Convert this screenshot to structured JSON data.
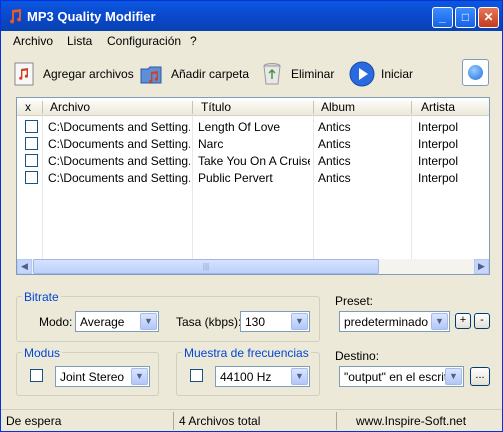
{
  "window": {
    "title": "MP3 Quality Modifier"
  },
  "menu": {
    "items": [
      "Archivo",
      "Lista",
      "Configuración",
      "?"
    ]
  },
  "toolbar": {
    "add_files": "Agregar archivos",
    "add_folder": "Añadir carpeta",
    "remove": "Eliminar",
    "start": "Iniciar"
  },
  "list": {
    "headers": [
      "x",
      "Archivo",
      "Título",
      "Album",
      "Artista"
    ],
    "rows": [
      {
        "file": "C:\\Documents and Setting...",
        "title": "Length Of Love",
        "album": "Antics",
        "artist": "Interpol"
      },
      {
        "file": "C:\\Documents and Setting...",
        "title": "Narc",
        "album": "Antics",
        "artist": "Interpol"
      },
      {
        "file": "C:\\Documents and Setting...",
        "title": "Take You On A Cruise",
        "album": "Antics",
        "artist": "Interpol"
      },
      {
        "file": "C:\\Documents and Setting...",
        "title": "Public Pervert",
        "album": "Antics",
        "artist": "Interpol"
      }
    ]
  },
  "bitrate": {
    "group_label": "Bitrate",
    "mode_label": "Modo:",
    "mode_value": "Average",
    "rate_label": "Tasa (kbps):",
    "rate_value": "130"
  },
  "preset": {
    "label": "Preset:",
    "value": "predeterminado",
    "add": "+",
    "remove": "-"
  },
  "modus": {
    "group_label": "Modus",
    "value": "Joint Stereo"
  },
  "sample": {
    "group_label": "Muestra de frecuencias",
    "value": "44100 Hz"
  },
  "destination": {
    "label": "Destino:",
    "value": "\"output\" en el escritor",
    "browse": "..."
  },
  "status": {
    "state": "De espera",
    "count": "4 Archivos total",
    "site": "www.Inspire-Soft.net"
  },
  "icons": {
    "app": "music-note-icon",
    "add_files": "music-file-icon",
    "add_folder": "music-folder-icon",
    "remove": "recycle-bin-icon",
    "start": "play-icon"
  }
}
